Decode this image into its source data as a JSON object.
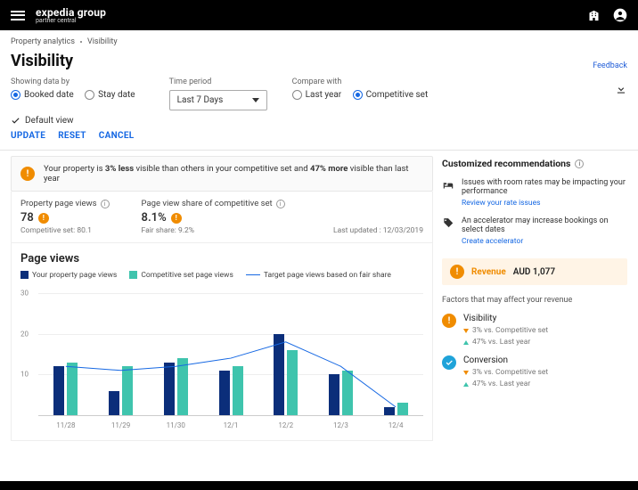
{
  "brand": {
    "line1": "expedia group",
    "line2": "partner central"
  },
  "breadcrumbs": [
    "Property analytics",
    "Visibility"
  ],
  "title": "Visibility",
  "feedback": "Feedback",
  "filters": {
    "showing_by": {
      "label": "Showing data by",
      "opt_booked": "Booked date",
      "opt_stay": "Stay date"
    },
    "time_period": {
      "label": "Time period",
      "value": "Last 7 Days"
    },
    "compare": {
      "label": "Compare with",
      "opt_last_year": "Last year",
      "opt_comp_set": "Competitive set"
    },
    "default_view": "Default view"
  },
  "actions": {
    "update": "UPDATE",
    "reset": "RESET",
    "cancel": "CANCEL"
  },
  "banner": {
    "prefix": "Your property is ",
    "bold1": "3% less",
    "mid": " visible than others in your competitive set and ",
    "bold2": "47% more",
    "suffix": " visible than last year"
  },
  "stats": {
    "views": {
      "label": "Property page views",
      "value": "78",
      "sub": "Competitive set: 80.1"
    },
    "share": {
      "label": "Page view share of competitive set",
      "value": "8.1%",
      "sub": "Fair share: 9.2%"
    },
    "updated": "Last updated : 12/03/2019"
  },
  "chart": {
    "title": "Page views",
    "legend": {
      "s1": "Your property page views",
      "s2": "Competitive set page views",
      "s3": "Target page views based on fair share"
    }
  },
  "chart_data": {
    "type": "bar",
    "categories": [
      "11/28",
      "11/29",
      "11/30",
      "12/1",
      "12/2",
      "12/3",
      "12/4"
    ],
    "series": [
      {
        "name": "Your property page views",
        "values": [
          12,
          6,
          13,
          11,
          20,
          10,
          2
        ],
        "color": "#0b2e7a"
      },
      {
        "name": "Competitive set page views",
        "values": [
          13,
          12,
          14,
          12,
          16,
          11,
          3
        ],
        "color": "#3fc4ad"
      },
      {
        "name": "Target page views based on fair share",
        "type": "line",
        "values": [
          12,
          11,
          12,
          14,
          18,
          12,
          2
        ],
        "color": "#1668e3"
      }
    ],
    "ylabel": "",
    "ylim": [
      0,
      30
    ],
    "yticks": [
      10,
      20,
      30
    ]
  },
  "side": {
    "header": "Customized recommendations",
    "rec1": {
      "text": "Issues with room rates may be impacting your performance",
      "link": "Review your rate issues"
    },
    "rec2": {
      "text": "An accelerator may increase bookings on select dates",
      "link": "Create accelerator"
    },
    "revenue": {
      "label": "Revenue",
      "amount": "AUD 1,077"
    },
    "factors_h": "Factors that may affect your revenue",
    "factor_vis": {
      "title": "Visibility",
      "l1": "3% vs. Competitive set",
      "l2": "47% vs. Last year"
    },
    "factor_conv": {
      "title": "Conversion",
      "l1": "3% vs. Competitive set",
      "l2": "47% vs. Last year"
    }
  }
}
